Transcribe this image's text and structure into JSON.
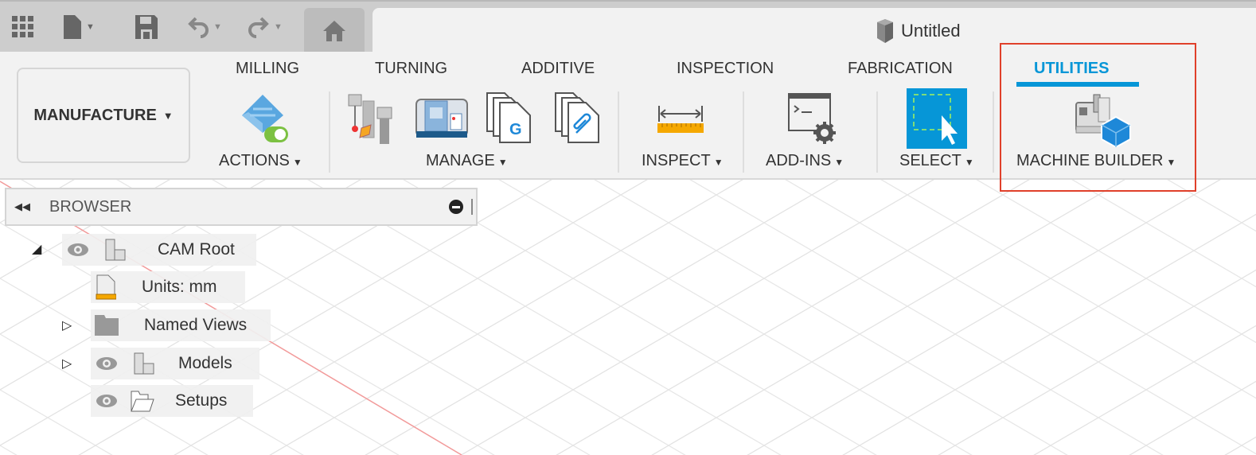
{
  "quick_access": {
    "icons": [
      "apps-grid-icon",
      "file-icon",
      "save-icon",
      "undo-icon",
      "redo-icon",
      "home-icon"
    ]
  },
  "document": {
    "title": "Untitled"
  },
  "workspace": {
    "label": "MANUFACTURE"
  },
  "tabs": [
    {
      "label": "MILLING",
      "active": false
    },
    {
      "label": "TURNING",
      "active": false
    },
    {
      "label": "ADDITIVE",
      "active": false
    },
    {
      "label": "INSPECTION",
      "active": false
    },
    {
      "label": "FABRICATION",
      "active": false
    },
    {
      "label": "UTILITIES",
      "active": true
    }
  ],
  "groups": {
    "actions": "ACTIONS",
    "manage": "MANAGE",
    "inspect": "INSPECT",
    "addins": "ADD-INS",
    "select": "SELECT",
    "machine_builder": "MACHINE BUILDER"
  },
  "browser": {
    "title": "BROWSER",
    "items": [
      {
        "label": "CAM Root"
      },
      {
        "label": "Units: mm"
      },
      {
        "label": "Named Views"
      },
      {
        "label": "Models"
      },
      {
        "label": "Setups"
      }
    ]
  },
  "colors": {
    "accent": "#0696d7",
    "highlight": "#e0402a"
  }
}
